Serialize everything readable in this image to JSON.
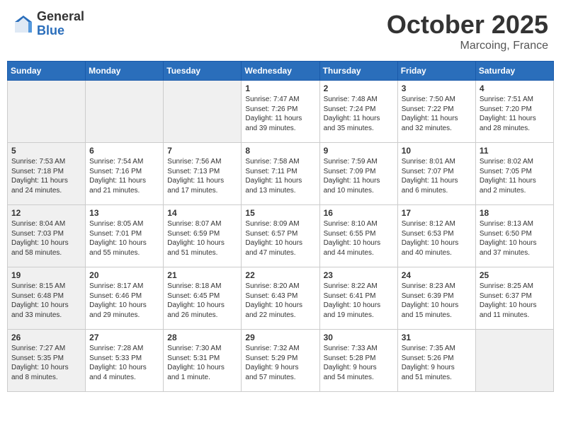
{
  "header": {
    "logo_general": "General",
    "logo_blue": "Blue",
    "month_title": "October 2025",
    "location": "Marcoing, France"
  },
  "days_of_week": [
    "Sunday",
    "Monday",
    "Tuesday",
    "Wednesday",
    "Thursday",
    "Friday",
    "Saturday"
  ],
  "weeks": [
    [
      {
        "day": "",
        "info": "",
        "shaded": true
      },
      {
        "day": "",
        "info": "",
        "shaded": true
      },
      {
        "day": "",
        "info": "",
        "shaded": true
      },
      {
        "day": "1",
        "info": "Sunrise: 7:47 AM\nSunset: 7:26 PM\nDaylight: 11 hours\nand 39 minutes.",
        "shaded": false
      },
      {
        "day": "2",
        "info": "Sunrise: 7:48 AM\nSunset: 7:24 PM\nDaylight: 11 hours\nand 35 minutes.",
        "shaded": false
      },
      {
        "day": "3",
        "info": "Sunrise: 7:50 AM\nSunset: 7:22 PM\nDaylight: 11 hours\nand 32 minutes.",
        "shaded": false
      },
      {
        "day": "4",
        "info": "Sunrise: 7:51 AM\nSunset: 7:20 PM\nDaylight: 11 hours\nand 28 minutes.",
        "shaded": false
      }
    ],
    [
      {
        "day": "5",
        "info": "Sunrise: 7:53 AM\nSunset: 7:18 PM\nDaylight: 11 hours\nand 24 minutes.",
        "shaded": true
      },
      {
        "day": "6",
        "info": "Sunrise: 7:54 AM\nSunset: 7:16 PM\nDaylight: 11 hours\nand 21 minutes.",
        "shaded": false
      },
      {
        "day": "7",
        "info": "Sunrise: 7:56 AM\nSunset: 7:13 PM\nDaylight: 11 hours\nand 17 minutes.",
        "shaded": false
      },
      {
        "day": "8",
        "info": "Sunrise: 7:58 AM\nSunset: 7:11 PM\nDaylight: 11 hours\nand 13 minutes.",
        "shaded": false
      },
      {
        "day": "9",
        "info": "Sunrise: 7:59 AM\nSunset: 7:09 PM\nDaylight: 11 hours\nand 10 minutes.",
        "shaded": false
      },
      {
        "day": "10",
        "info": "Sunrise: 8:01 AM\nSunset: 7:07 PM\nDaylight: 11 hours\nand 6 minutes.",
        "shaded": false
      },
      {
        "day": "11",
        "info": "Sunrise: 8:02 AM\nSunset: 7:05 PM\nDaylight: 11 hours\nand 2 minutes.",
        "shaded": false
      }
    ],
    [
      {
        "day": "12",
        "info": "Sunrise: 8:04 AM\nSunset: 7:03 PM\nDaylight: 10 hours\nand 58 minutes.",
        "shaded": true
      },
      {
        "day": "13",
        "info": "Sunrise: 8:05 AM\nSunset: 7:01 PM\nDaylight: 10 hours\nand 55 minutes.",
        "shaded": false
      },
      {
        "day": "14",
        "info": "Sunrise: 8:07 AM\nSunset: 6:59 PM\nDaylight: 10 hours\nand 51 minutes.",
        "shaded": false
      },
      {
        "day": "15",
        "info": "Sunrise: 8:09 AM\nSunset: 6:57 PM\nDaylight: 10 hours\nand 47 minutes.",
        "shaded": false
      },
      {
        "day": "16",
        "info": "Sunrise: 8:10 AM\nSunset: 6:55 PM\nDaylight: 10 hours\nand 44 minutes.",
        "shaded": false
      },
      {
        "day": "17",
        "info": "Sunrise: 8:12 AM\nSunset: 6:53 PM\nDaylight: 10 hours\nand 40 minutes.",
        "shaded": false
      },
      {
        "day": "18",
        "info": "Sunrise: 8:13 AM\nSunset: 6:50 PM\nDaylight: 10 hours\nand 37 minutes.",
        "shaded": false
      }
    ],
    [
      {
        "day": "19",
        "info": "Sunrise: 8:15 AM\nSunset: 6:48 PM\nDaylight: 10 hours\nand 33 minutes.",
        "shaded": true
      },
      {
        "day": "20",
        "info": "Sunrise: 8:17 AM\nSunset: 6:46 PM\nDaylight: 10 hours\nand 29 minutes.",
        "shaded": false
      },
      {
        "day": "21",
        "info": "Sunrise: 8:18 AM\nSunset: 6:45 PM\nDaylight: 10 hours\nand 26 minutes.",
        "shaded": false
      },
      {
        "day": "22",
        "info": "Sunrise: 8:20 AM\nSunset: 6:43 PM\nDaylight: 10 hours\nand 22 minutes.",
        "shaded": false
      },
      {
        "day": "23",
        "info": "Sunrise: 8:22 AM\nSunset: 6:41 PM\nDaylight: 10 hours\nand 19 minutes.",
        "shaded": false
      },
      {
        "day": "24",
        "info": "Sunrise: 8:23 AM\nSunset: 6:39 PM\nDaylight: 10 hours\nand 15 minutes.",
        "shaded": false
      },
      {
        "day": "25",
        "info": "Sunrise: 8:25 AM\nSunset: 6:37 PM\nDaylight: 10 hours\nand 11 minutes.",
        "shaded": false
      }
    ],
    [
      {
        "day": "26",
        "info": "Sunrise: 7:27 AM\nSunset: 5:35 PM\nDaylight: 10 hours\nand 8 minutes.",
        "shaded": true
      },
      {
        "day": "27",
        "info": "Sunrise: 7:28 AM\nSunset: 5:33 PM\nDaylight: 10 hours\nand 4 minutes.",
        "shaded": false
      },
      {
        "day": "28",
        "info": "Sunrise: 7:30 AM\nSunset: 5:31 PM\nDaylight: 10 hours\nand 1 minute.",
        "shaded": false
      },
      {
        "day": "29",
        "info": "Sunrise: 7:32 AM\nSunset: 5:29 PM\nDaylight: 9 hours\nand 57 minutes.",
        "shaded": false
      },
      {
        "day": "30",
        "info": "Sunrise: 7:33 AM\nSunset: 5:28 PM\nDaylight: 9 hours\nand 54 minutes.",
        "shaded": false
      },
      {
        "day": "31",
        "info": "Sunrise: 7:35 AM\nSunset: 5:26 PM\nDaylight: 9 hours\nand 51 minutes.",
        "shaded": false
      },
      {
        "day": "",
        "info": "",
        "shaded": true
      }
    ]
  ]
}
